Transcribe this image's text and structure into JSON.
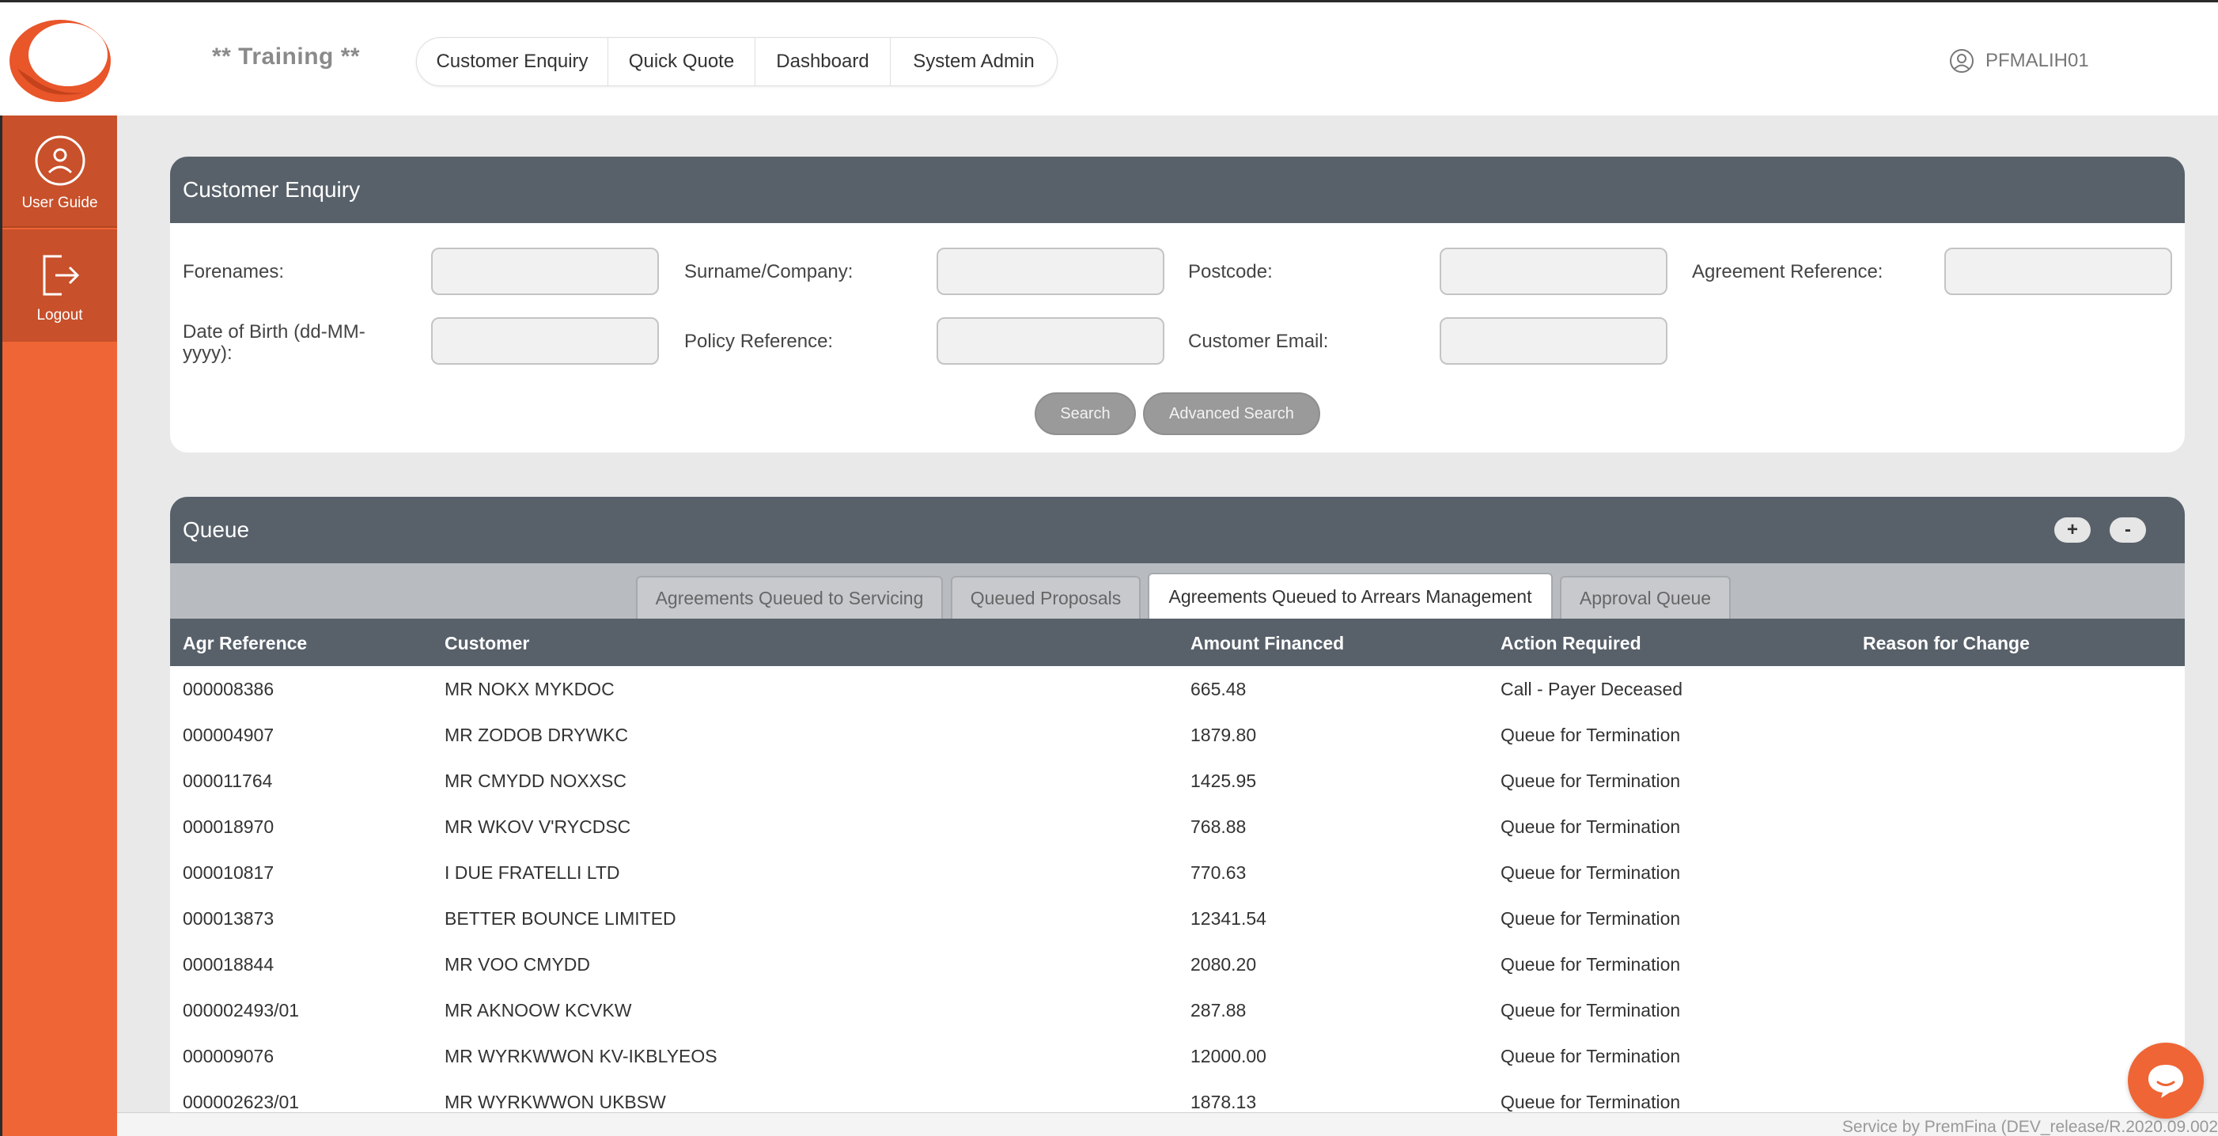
{
  "header": {
    "env_title": "** Training **",
    "nav": [
      "Customer Enquiry",
      "Quick Quote",
      "Dashboard",
      "System Admin"
    ],
    "username": "PFMALIH01"
  },
  "sidebar": {
    "user_guide": "User Guide",
    "logout": "Logout"
  },
  "enquiry": {
    "title": "Customer Enquiry",
    "labels": {
      "forenames": "Forenames:",
      "surname": "Surname/Company:",
      "postcode": "Postcode:",
      "agreement_ref": "Agreement Reference:",
      "dob": "Date of Birth (dd-MM-yyyy):",
      "policy_ref": "Policy Reference:",
      "email": "Customer Email:"
    },
    "values": {
      "forenames": "",
      "surname": "",
      "postcode": "",
      "agreement_ref": "",
      "dob": "",
      "policy_ref": "",
      "email": ""
    },
    "search_label": "Search",
    "advanced_search_label": "Advanced Search"
  },
  "queue": {
    "title": "Queue",
    "expand_label": "+",
    "collapse_label": "-",
    "tabs": [
      "Agreements Queued to Servicing",
      "Queued Proposals",
      "Agreements Queued to Arrears Management",
      "Approval Queue"
    ],
    "active_tab": 2,
    "columns": [
      "Agr Reference",
      "Customer",
      "Amount Financed",
      "Action Required",
      "Reason for Change"
    ],
    "rows": [
      [
        "000008386",
        "MR NOKX MYKDOC",
        "665.48",
        "Call - Payer Deceased",
        ""
      ],
      [
        "000004907",
        "MR ZODOB DRYWKC",
        "1879.80",
        "Queue for Termination",
        ""
      ],
      [
        "000011764",
        "MR CMYDD NOXXSC",
        "1425.95",
        "Queue for Termination",
        ""
      ],
      [
        "000018970",
        "MR WKOV V'RYCDSC",
        "768.88",
        "Queue for Termination",
        ""
      ],
      [
        "000010817",
        "I DUE FRATELLI LTD",
        "770.63",
        "Queue for Termination",
        ""
      ],
      [
        "000013873",
        "BETTER BOUNCE LIMITED",
        "12341.54",
        "Queue for Termination",
        ""
      ],
      [
        "000018844",
        "MR VOO CMYDD",
        "2080.20",
        "Queue for Termination",
        ""
      ],
      [
        "000002493/01",
        "MR AKNOOW KCVKW",
        "287.88",
        "Queue for Termination",
        ""
      ],
      [
        "000009076",
        "MR WYRKWWON KV-IKBLYEOS",
        "12000.00",
        "Queue for Termination",
        ""
      ],
      [
        "000002623/01",
        "MR WYRKWWON UKBSW",
        "1878.13",
        "Queue for Termination",
        ""
      ]
    ]
  },
  "footer": {
    "text": "Service by PremFina (DEV_release/R.2020.09.002"
  },
  "colors": {
    "brand_orange": "#ef6535",
    "sidebar_dark": "#c8502b",
    "panel_header": "#58616a"
  },
  "icons": {
    "logo": "premfina-logo",
    "user": "user-circle-icon",
    "guide": "user-guide-icon",
    "logout": "logout-icon",
    "chat": "chat-bubble-icon"
  }
}
